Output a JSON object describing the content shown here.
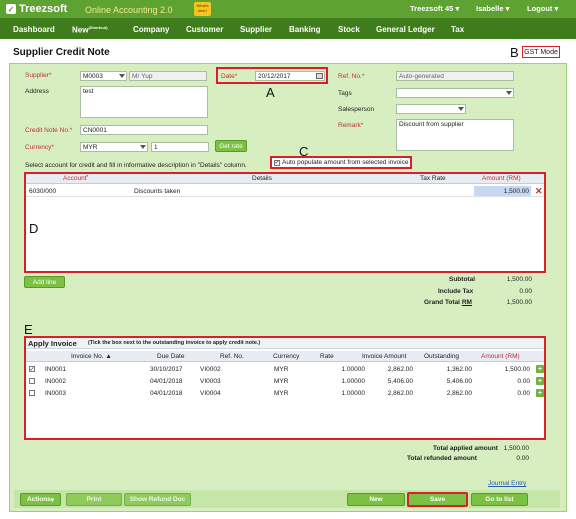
{
  "app": {
    "logo": "Treezsoft",
    "tagline": "Online Accounting 2.0",
    "whats_new": "What's new?",
    "company": "Treezsoft 45",
    "user": "Isabelle",
    "logout": "Logout"
  },
  "nav": [
    "Dashboard",
    "New",
    "Company",
    "Customer",
    "Supplier",
    "Banking",
    "Stock",
    "General Ledger",
    "Tax"
  ],
  "nav_shortcut": "(Shortcut)",
  "page": {
    "title": "Supplier Credit Note",
    "gst_mode": "GST Mode"
  },
  "form": {
    "supplier_label": "Supplier",
    "supplier_code": "M0003",
    "supplier_name": "Mr Yup",
    "address_label": "Address",
    "address": "test",
    "cn_label": "Credit Note No.",
    "cn": "CN0001",
    "currency_label": "Currency",
    "currency": "MYR",
    "rate": "1",
    "get_rate": "Get rate",
    "date_label": "Date",
    "date": "20/12/2017",
    "ref_label": "Ref. No.",
    "ref": "Auto-generated",
    "tags_label": "Tags",
    "salesperson_label": "Salesperson",
    "remark_label": "Remark",
    "remark": "Discount from supplier"
  },
  "annotations": {
    "a": "A",
    "b": "B",
    "c": "C",
    "d": "D",
    "e": "E"
  },
  "instr": "Select account for credit and fill in informative description in \"Details\" column.",
  "autopop": "Auto populate amount from selected invoice",
  "lines": {
    "headers": [
      "Account",
      "Details",
      "Tax Rate",
      "Amount (RM)"
    ],
    "row": {
      "account": "6030/000",
      "details": "Discounts taken",
      "tax": "",
      "amount": "1,500.00"
    },
    "add": "Add line"
  },
  "totals": {
    "subtotal_label": "Subtotal",
    "subtotal": "1,500.00",
    "tax_label": "Include Tax",
    "tax": "0.00",
    "grand_label": "Grand Total",
    "grand_currency": "RM",
    "grand": "1,500.00"
  },
  "apply": {
    "title": "Apply Invoice",
    "hint": "(Tick the box next to the outstanding invoice to apply credit note.)",
    "headers": [
      "Invoice No.",
      "Due Date",
      "Ref. No.",
      "Currency",
      "Rate",
      "Invoice Amount",
      "Outstanding",
      "Amount (RM)"
    ],
    "rows": [
      {
        "checked": true,
        "inv": "IN0001",
        "due": "30/10/2017",
        "ref": "VI0002",
        "cur": "MYR",
        "rate": "1.00000",
        "amt": "2,862.00",
        "out": "1,362.00",
        "apply": "1,500.00"
      },
      {
        "checked": false,
        "inv": "IN0002",
        "due": "04/01/2018",
        "ref": "VI0003",
        "cur": "MYR",
        "rate": "1.00000",
        "amt": "5,406.00",
        "out": "5,406.00",
        "apply": "0.00"
      },
      {
        "checked": false,
        "inv": "IN0003",
        "due": "04/01/2018",
        "ref": "VI0004",
        "cur": "MYR",
        "rate": "1.00000",
        "amt": "2,862.00",
        "out": "2,862.00",
        "apply": "0.00"
      }
    ],
    "applied_label": "Total applied amount",
    "applied": "1,500.00",
    "refunded_label": "Total refunded amount",
    "refunded": "0.00",
    "journal": "Journal Entry"
  },
  "footer": {
    "actions": "Actions",
    "print": "Print",
    "refund": "Show Refund Doc",
    "new": "New",
    "save": "Save",
    "goto": "Go to list"
  },
  "colors": {
    "topbar": "#5ea331",
    "navbar": "#3f7d1c",
    "panel": "#d7efc0",
    "button": "#7cc143",
    "highlight": "#d6202a"
  }
}
